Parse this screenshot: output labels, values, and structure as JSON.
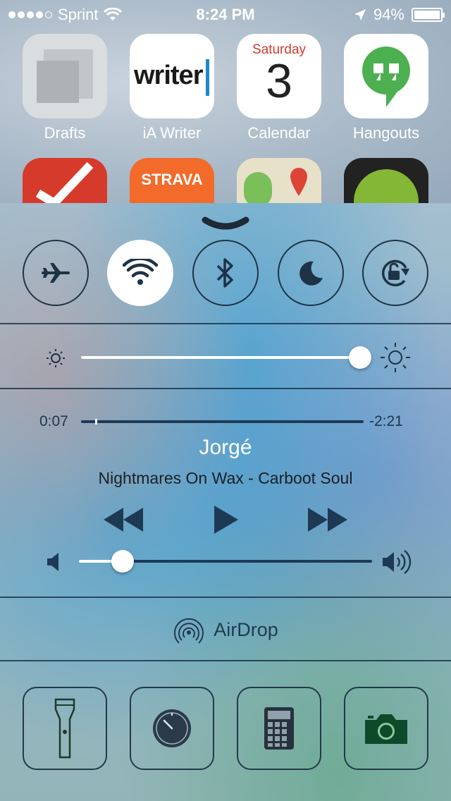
{
  "status_bar": {
    "carrier": "Sprint",
    "time": "8:24 PM",
    "battery_percent": "94%",
    "signal_bars_filled": 4,
    "signal_bars_total": 5
  },
  "home_apps_row1": [
    {
      "label": "Drafts",
      "icon": "drafts-icon"
    },
    {
      "label": "iA Writer",
      "icon": "ia-writer-icon",
      "icon_text": "writer"
    },
    {
      "label": "Calendar",
      "icon": "calendar-icon",
      "day_name": "Saturday",
      "day_number": "3"
    },
    {
      "label": "Hangouts",
      "icon": "hangouts-icon"
    }
  ],
  "home_apps_row2": [
    {
      "icon": "todo-checkmark-icon"
    },
    {
      "icon": "strava-icon",
      "icon_text": "STRAVA"
    },
    {
      "icon": "maps-icon"
    },
    {
      "icon": "spotify-icon"
    }
  ],
  "control_center": {
    "toggles": [
      {
        "name": "airplane-mode",
        "icon": "airplane-icon",
        "on": false
      },
      {
        "name": "wifi",
        "icon": "wifi-icon",
        "on": true
      },
      {
        "name": "bluetooth",
        "icon": "bluetooth-icon",
        "on": false
      },
      {
        "name": "do-not-disturb",
        "icon": "moon-icon",
        "on": false
      },
      {
        "name": "rotation-lock",
        "icon": "rotation-lock-icon",
        "on": false
      }
    ],
    "brightness": {
      "level": 1.0
    },
    "now_playing": {
      "elapsed": "0:07",
      "remaining": "-2:21",
      "progress": 0.05,
      "title": "Jorgé",
      "subtitle": "Nightmares On Wax - Carboot Soul"
    },
    "volume": {
      "level": 0.15
    },
    "airdrop_label": "AirDrop",
    "shortcuts": [
      {
        "name": "flashlight",
        "icon": "flashlight-icon"
      },
      {
        "name": "timer",
        "icon": "timer-icon"
      },
      {
        "name": "calculator",
        "icon": "calculator-icon"
      },
      {
        "name": "camera",
        "icon": "camera-icon"
      }
    ]
  },
  "colors": {
    "accent_dark": "#1d3a55",
    "hangouts_green": "#4caf50",
    "calendar_red": "#d33b2f"
  }
}
